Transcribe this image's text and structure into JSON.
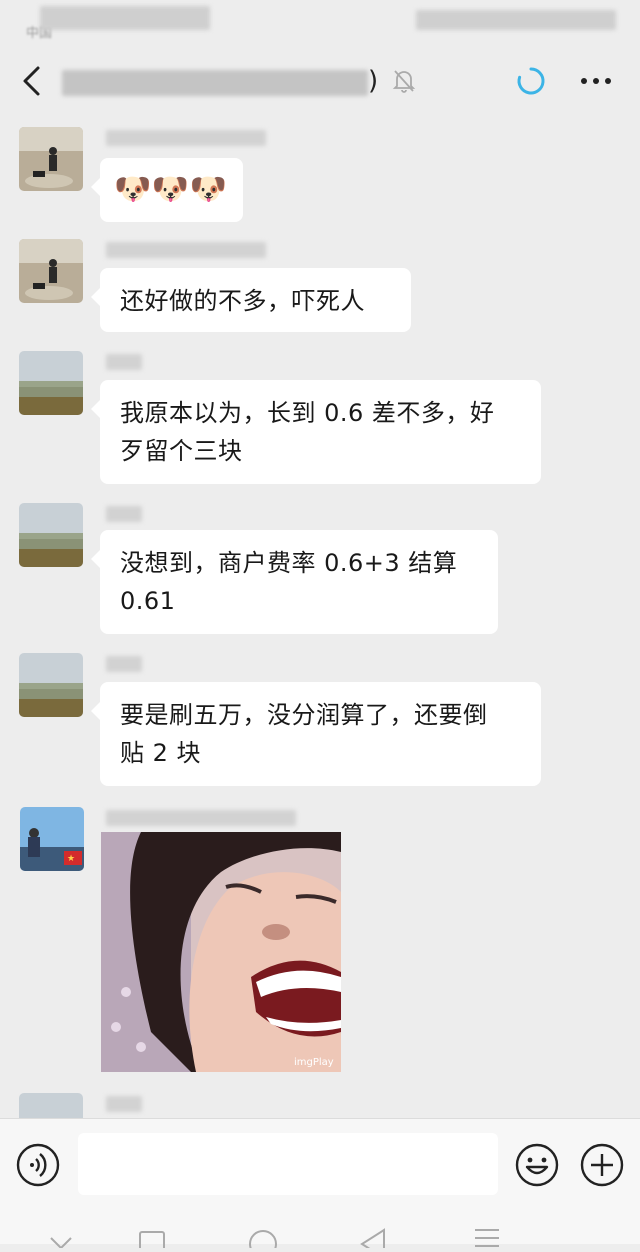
{
  "status_bar": {
    "carrier": "中国"
  },
  "header": {
    "title_suffix": ")",
    "back_icon": "chevron-left-icon",
    "mute_icon": "bell-off-icon",
    "loading_icon": "loading-spinner-icon",
    "more_icon": "more-dots-icon"
  },
  "messages": [
    {
      "type": "emoji",
      "emoji": [
        "🐶",
        "🐶",
        "🐶"
      ]
    },
    {
      "type": "text",
      "text": "还好做的不多，吓死人"
    },
    {
      "type": "text",
      "lines": [
        "我原本以为，长到 0.6 差不多，好",
        "歹留个三块"
      ]
    },
    {
      "type": "text",
      "lines": [
        "没想到，商户费率 0.6+3  结算",
        "0.61"
      ]
    },
    {
      "type": "text",
      "lines": [
        "要是刷五万，没分润算了，还要倒",
        "贴 2 块"
      ]
    },
    {
      "type": "image",
      "watermark": "imgPlay"
    }
  ],
  "input_bar": {
    "voice_icon": "voice-icon",
    "emoji_icon": "emoji-smile-icon",
    "plus_icon": "plus-icon",
    "placeholder": ""
  },
  "colors": {
    "background": "#ededed",
    "bubble": "#ffffff",
    "accent": "#3cb4e6"
  }
}
